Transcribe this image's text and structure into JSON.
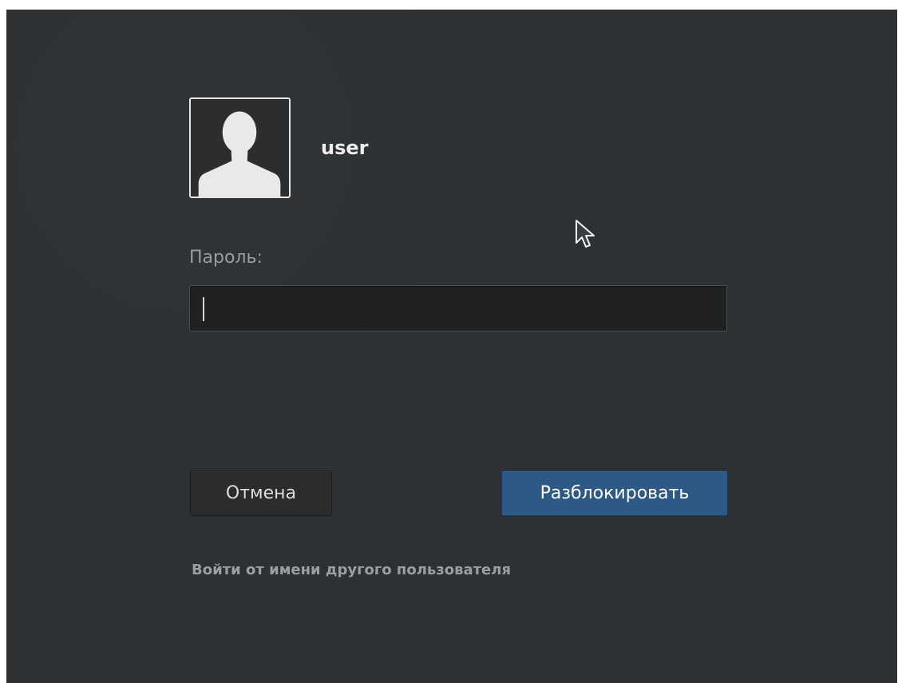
{
  "user": {
    "name": "user",
    "avatar_icon": "default-user-silhouette-icon"
  },
  "password": {
    "label": "Пароль:",
    "value": ""
  },
  "buttons": {
    "cancel_label": "Отмена",
    "unlock_label": "Разблокировать"
  },
  "links": {
    "switch_user_label": "Войти от имени другого пользователя"
  },
  "icons": {
    "pointer": "mouse-pointer-icon"
  },
  "colors": {
    "background": "#2d3032",
    "accent_button": "#2c5985",
    "text_primary": "#eeeeee",
    "text_secondary": "#9a9c9d"
  }
}
